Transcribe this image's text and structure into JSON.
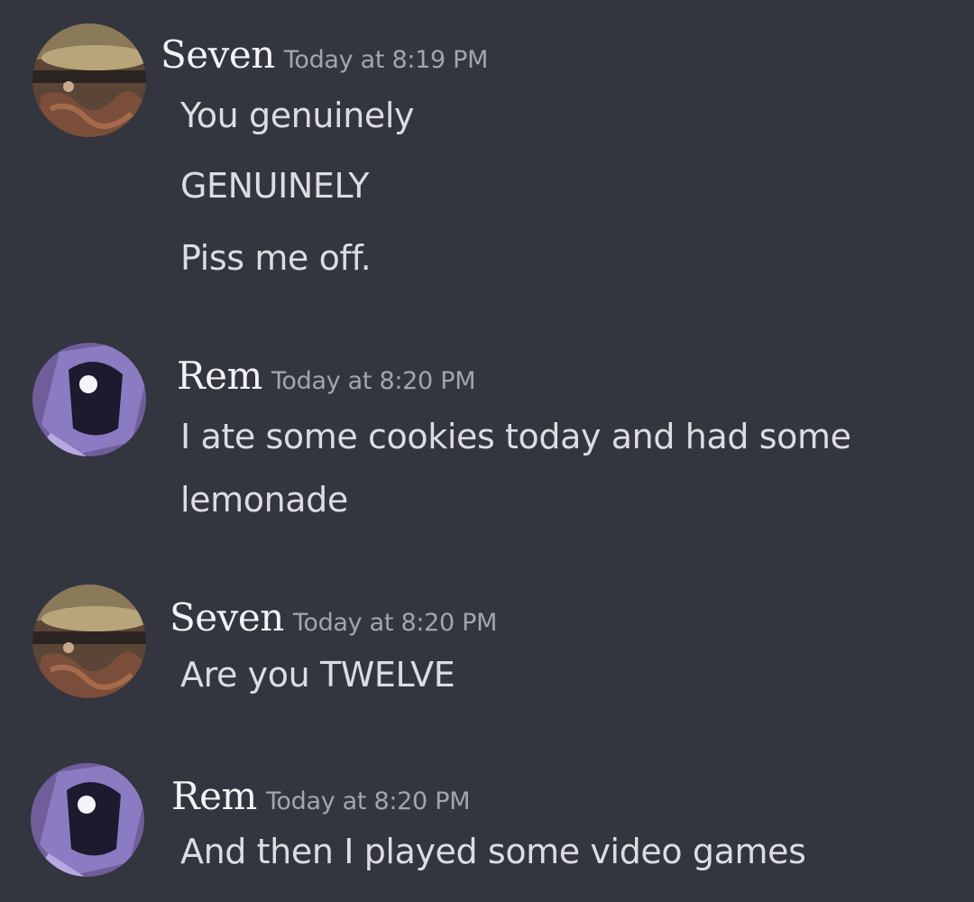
{
  "messages": [
    {
      "author": "Seven",
      "timestamp": "Today at 8:19 PM",
      "lines": [
        "You genuinely",
        "GENUINELY",
        "Piss me off."
      ]
    },
    {
      "author": "Rem",
      "timestamp": "Today at 8:20 PM",
      "lines": [
        "I ate some cookies today and had some",
        "lemonade"
      ]
    },
    {
      "author": "Seven",
      "timestamp": "Today at 8:20 PM",
      "lines": [
        "Are you TWELVE"
      ]
    },
    {
      "author": "Rem",
      "timestamp": "Today at 8:20 PM",
      "lines": [
        "And then I played some video games"
      ]
    }
  ],
  "colors": {
    "background": "#33353f",
    "author": "#f2f3f5",
    "timestamp": "#a3a6ae",
    "message_text": "#dcdde1"
  }
}
